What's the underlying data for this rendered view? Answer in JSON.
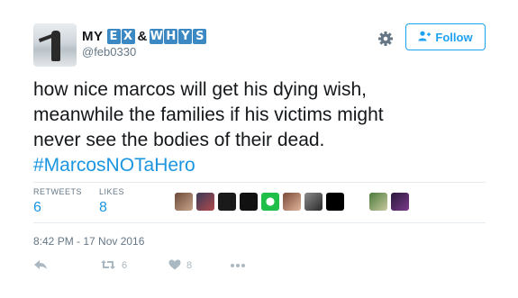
{
  "header": {
    "name_prefix": "MY",
    "name_tiles_1": [
      "E",
      "X"
    ],
    "name_amp": "&",
    "name_tiles_2": [
      "W",
      "H",
      "Y",
      "S"
    ],
    "handle": "@feb0330",
    "follow_label": "Follow"
  },
  "tweet": {
    "text": "how nice marcos will get his dying wish,\nmeanwhile the families if his victims might\nnever see the bodies of their dead.",
    "hashtag": "#MarcosNOTaHero"
  },
  "stats": {
    "retweets_label": "RETWEETS",
    "retweets_count": "6",
    "likes_label": "LIKES",
    "likes_count": "8"
  },
  "timestamp": "8:42 PM - 17 Nov 2016",
  "actions": {
    "retweet_count": "6",
    "like_count": "8"
  },
  "colors": {
    "accent": "#1da1f2",
    "link": "#1b95e0",
    "tile": "#3b88c3",
    "muted": "#657786"
  },
  "icons": [
    "settings-gear-icon",
    "follow-person-icon",
    "reply-icon",
    "retweet-icon",
    "heart-icon",
    "more-icon"
  ]
}
